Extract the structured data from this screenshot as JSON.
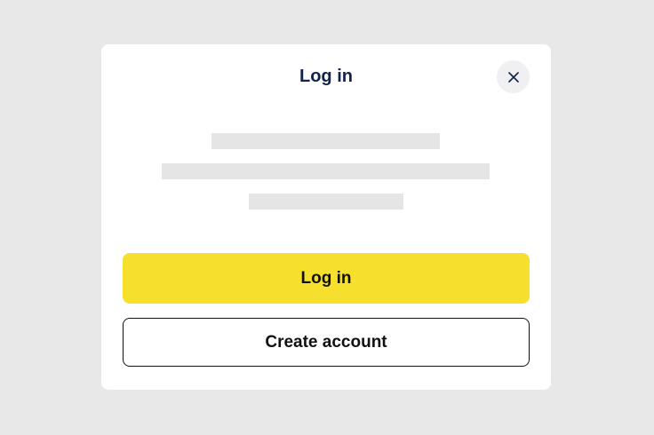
{
  "dialog": {
    "title": "Log in",
    "close_icon": "close-icon",
    "login_button_label": "Log in",
    "create_account_button_label": "Create account"
  },
  "colors": {
    "backdrop": "#e8e8e8",
    "modal_background": "#ffffff",
    "title_text": "#13224a",
    "primary_button": "#f7df2e",
    "skeleton": "#e5e5e5",
    "close_button_bg": "#f0f0f2"
  }
}
